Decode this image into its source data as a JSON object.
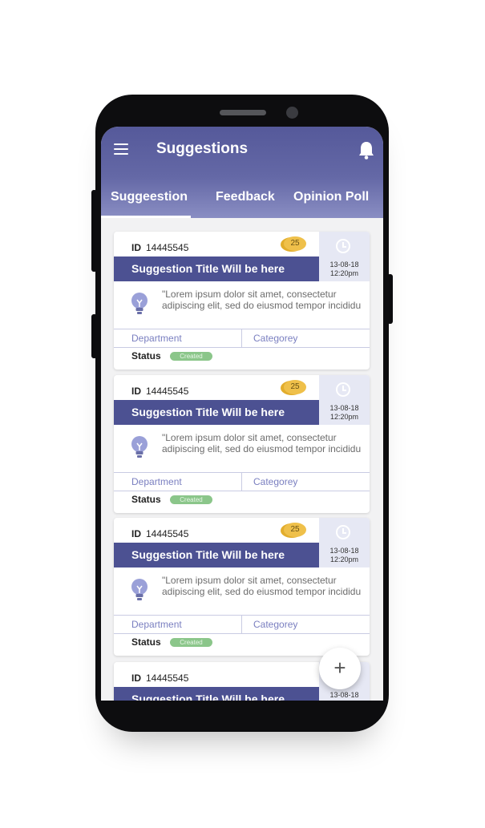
{
  "app": {
    "title": "Suggestions"
  },
  "tabs": [
    {
      "label": "Suggeestion",
      "active": true
    },
    {
      "label": "Feedback",
      "active": false
    },
    {
      "label": "Opinion Poll",
      "active": false
    }
  ],
  "cards": [
    {
      "id_label": "ID",
      "id": "14445545",
      "points": "25",
      "title": "Suggestion Title Will be here",
      "date": "13-08-18",
      "time": "12:20pm",
      "description": "\"Lorem ipsum dolor sit amet, consectetur adipiscing elit, sed do eiusmod tempor incididu",
      "department": "Department",
      "category": "Categorey",
      "status_label": "Status",
      "status": "Created"
    },
    {
      "id_label": "ID",
      "id": "14445545",
      "points": "25",
      "title": "Suggestion Title Will be here",
      "date": "13-08-18",
      "time": "12:20pm",
      "description": "\"Lorem ipsum dolor sit amet, consectetur adipiscing elit, sed do eiusmod tempor incididu",
      "department": "Department",
      "category": "Categorey",
      "status_label": "Status",
      "status": "Created"
    },
    {
      "id_label": "ID",
      "id": "14445545",
      "points": "25",
      "title": "Suggestion Title Will be here",
      "date": "13-08-18",
      "time": "12:20pm",
      "description": "\"Lorem ipsum dolor sit amet, consectetur adipiscing elit, sed do eiusmod tempor incididu",
      "department": "Department",
      "category": "Categorey",
      "status_label": "Status",
      "status": "Created"
    },
    {
      "id_label": "ID",
      "id": "14445545",
      "title": "Suggestion Title Will be here",
      "date": "13-08-18"
    }
  ],
  "fab": {
    "icon": "plus-icon",
    "label": "+"
  },
  "colors": {
    "primary": "#4c5192",
    "badge": "#8bc68a",
    "coin": "#efc04a",
    "link": "#7a7fc0"
  }
}
